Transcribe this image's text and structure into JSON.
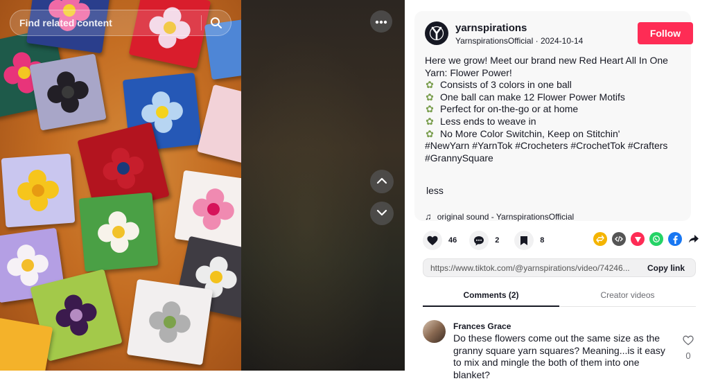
{
  "search": {
    "placeholder": "Find related content"
  },
  "icons": {
    "search": "search-icon",
    "more": "more-horizontal-icon",
    "up": "chevron-up-icon",
    "down": "chevron-down-icon",
    "heart": "heart-icon",
    "comment": "comment-icon",
    "bookmark": "bookmark-icon",
    "repost": "repost-icon",
    "embed": "embed-icon",
    "paper_plane": "send-icon",
    "whatsapp": "whatsapp-icon",
    "facebook": "facebook-icon",
    "share": "share-arrow-icon",
    "music": "music-note-icon",
    "flower_bullet": "flower-emoji-icon"
  },
  "author": {
    "username": "yarnspirations",
    "nickname": "YarnspirationsOfficial",
    "separator": " · ",
    "date": "2024-10-14",
    "follow_label": "Follow"
  },
  "description": {
    "intro": "Here we grow! Meet our brand new Red Heart All In One Yarn: Flower Power!",
    "bullets": [
      "Consists of 3 colors in one ball",
      "One ball can make 12 Flower Power Motifs",
      "Perfect for on-the-go or at home",
      "Less ends to weave in",
      "No More Color Switchin, Keep on Stitchin'"
    ],
    "hashtags": "#NewYarn #YarnTok #Crocheters #CrochetTok #Crafters #GrannySquare",
    "less_label": "less"
  },
  "sound": {
    "label": "original sound - YarnspirationsOfficial"
  },
  "stats": {
    "likes": "46",
    "comments": "2",
    "saves": "8"
  },
  "link": {
    "url": "https://www.tiktok.com/@yarnspirations/video/74246...",
    "copy_label": "Copy link"
  },
  "tabs": [
    {
      "label": "Comments (2)",
      "active": true
    },
    {
      "label": "Creator videos",
      "active": false
    }
  ],
  "comments": [
    {
      "author": "Frances Grace",
      "text": "Do these flowers come out the same size as the granny square yarn squares? Meaning...is it easy to mix and mingle the both of them into one blanket?",
      "likes": "0"
    }
  ],
  "colors": {
    "follow": "#fe2c55",
    "share_repost": "#f4b400",
    "share_embed": "#555555",
    "share_send": "#fe2c55",
    "share_whatsapp": "#25d366",
    "share_facebook": "#1877f2",
    "video_background": "#c8742c"
  }
}
